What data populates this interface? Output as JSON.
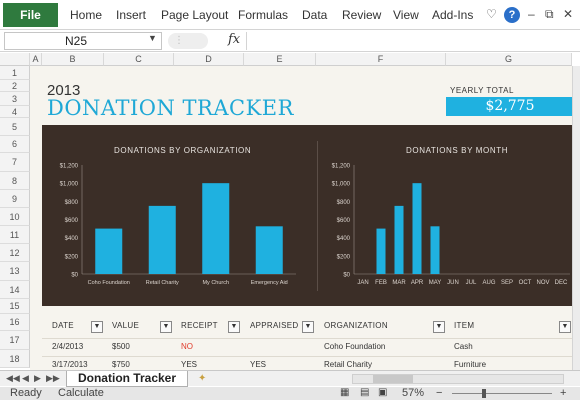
{
  "ribbon": {
    "file": "File",
    "tabs": [
      "Home",
      "Insert",
      "Page Layout",
      "Formulas",
      "Data",
      "Review",
      "View",
      "Add-Ins"
    ],
    "help": "?"
  },
  "formula_bar": {
    "name_box": "N25",
    "fx": "fx",
    "formula": ""
  },
  "columns": [
    "A",
    "B",
    "C",
    "D",
    "E",
    "F",
    "G"
  ],
  "rows": [
    "1",
    "2",
    "3",
    "4",
    "5",
    "6",
    "7",
    "8",
    "9",
    "10",
    "11",
    "12",
    "13",
    "14",
    "15",
    "16",
    "17",
    "18"
  ],
  "sheet": {
    "year": "2013",
    "title": "DONATION TRACKER",
    "yearly_total_label": "YEARLY TOTAL",
    "yearly_total_value": "$2,775"
  },
  "colors": {
    "accent": "#1FB1E0",
    "dashboard_bg": "#3B2E27",
    "file_tab": "#2F7A3E",
    "no_red": "#E03B2B"
  },
  "chart_data": [
    {
      "type": "bar",
      "title": "DONATIONS  BY ORGANIZATION",
      "categories": [
        "Coho Foundation",
        "Retail Charity",
        "My Church",
        "Emergency Aid"
      ],
      "values": [
        500,
        750,
        1000,
        525
      ],
      "ylim": [
        0,
        1200
      ],
      "yticks": [
        "$0",
        "$200",
        "$400",
        "$600",
        "$800",
        "$1,000",
        "$1,200"
      ],
      "xlabel": "",
      "ylabel": "",
      "grid": false
    },
    {
      "type": "bar",
      "title": "DONATIONS  BY MONTH",
      "categories": [
        "JAN",
        "FEB",
        "MAR",
        "APR",
        "MAY",
        "JUN",
        "JUL",
        "AUG",
        "SEP",
        "OCT",
        "NOV",
        "DEC"
      ],
      "values": [
        0,
        500,
        750,
        1000,
        525,
        0,
        0,
        0,
        0,
        0,
        0,
        0
      ],
      "ylim": [
        0,
        1200
      ],
      "yticks": [
        "$0",
        "$200",
        "$400",
        "$600",
        "$800",
        "$1,000",
        "$1,200"
      ],
      "xlabel": "",
      "ylabel": "",
      "grid": false
    }
  ],
  "table": {
    "headers": [
      "DATE",
      "VALUE",
      "RECEIPT",
      "APPRAISED",
      "ORGANIZATION",
      "ITEM"
    ],
    "rows": [
      [
        "2/4/2013",
        "$500",
        "NO",
        "",
        "Coho Foundation",
        "Cash"
      ],
      [
        "3/17/2013",
        "$750",
        "YES",
        "YES",
        "Retail Charity",
        "Furniture"
      ]
    ]
  },
  "sheet_tabs": {
    "active": "Donation Tracker"
  },
  "status": {
    "left": "Ready",
    "calc": "Calculate",
    "zoom": "57%"
  }
}
